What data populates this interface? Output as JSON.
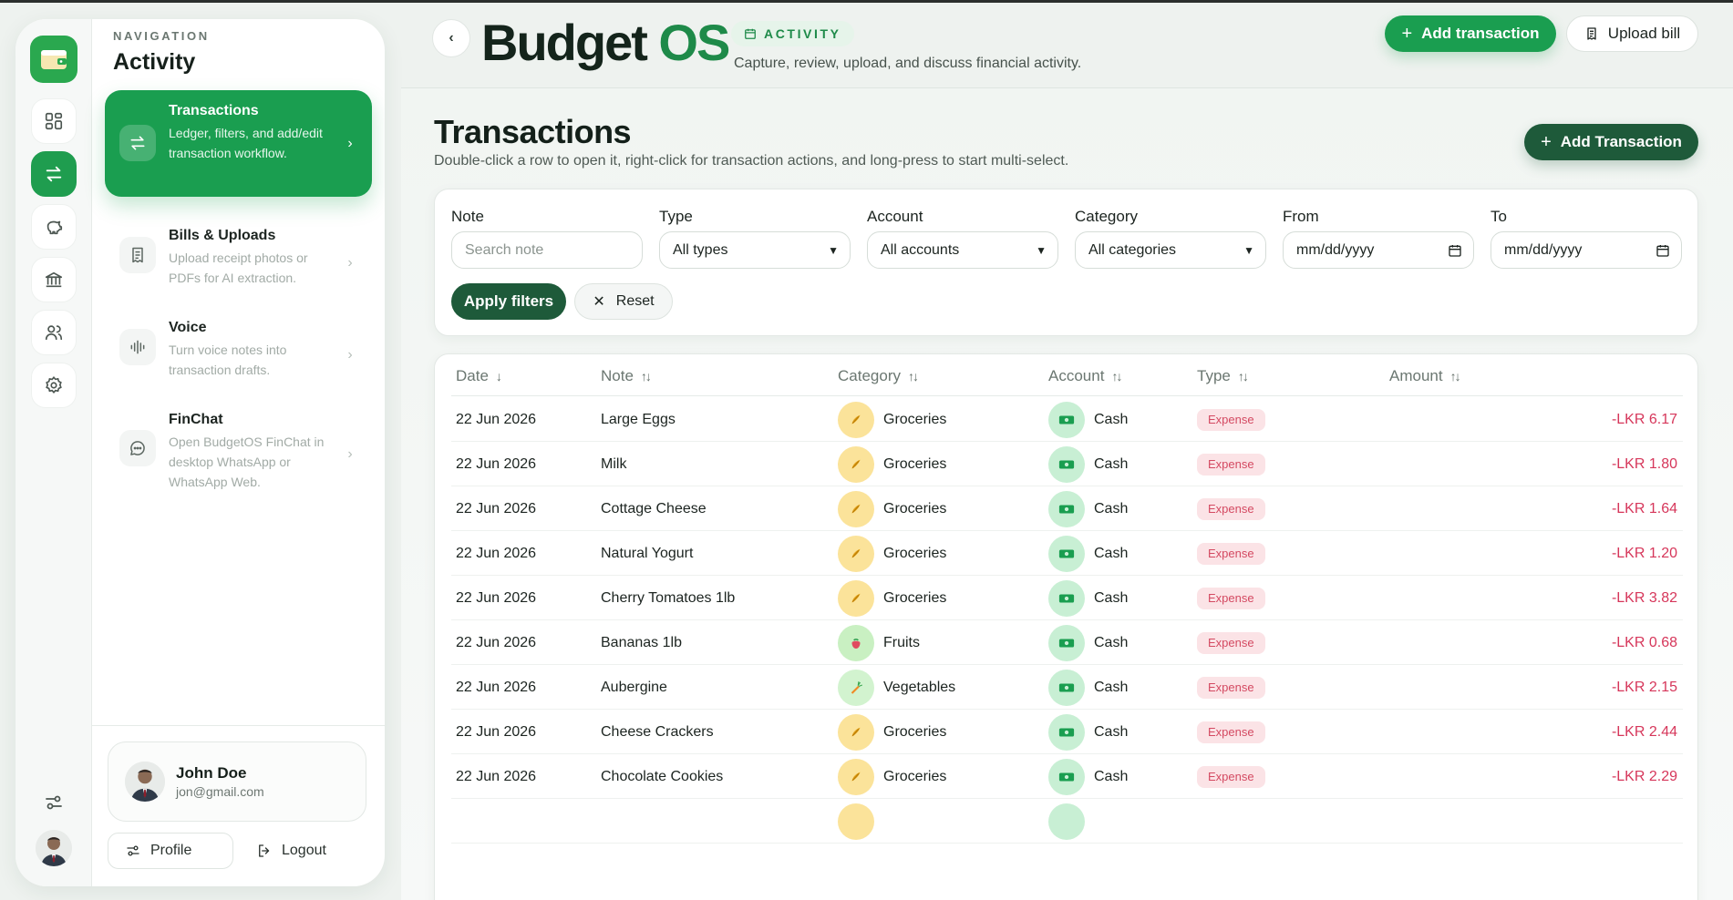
{
  "sidebar": {
    "eyebrow": "NAVIGATION",
    "title": "Activity",
    "items": [
      {
        "label": "Transactions",
        "desc": "Ledger, filters, and add/edit transaction workflow.",
        "icon": "arrows-swap-icon",
        "active": true
      },
      {
        "label": "Bills & Uploads",
        "desc": "Upload receipt photos or PDFs for AI extraction.",
        "icon": "receipt-icon",
        "active": false
      },
      {
        "label": "Voice",
        "desc": "Turn voice notes into transaction drafts.",
        "icon": "waveform-icon",
        "active": false
      },
      {
        "label": "FinChat",
        "desc": "Open BudgetOS FinChat in desktop WhatsApp or WhatsApp Web.",
        "icon": "chat-icon",
        "active": false
      }
    ],
    "rail_icons": [
      "wallet-logo-icon",
      "dashboard-icon",
      "arrows-swap-icon",
      "piggy-bank-icon",
      "bank-icon",
      "users-icon",
      "gear-icon",
      "sliders-icon"
    ],
    "user": {
      "name": "John Doe",
      "email": "jon@gmail.com"
    },
    "profile_label": "Profile",
    "logout_label": "Logout"
  },
  "header": {
    "brand_part1": "Budget",
    "brand_part2": "OS",
    "badge": "ACTIVITY",
    "subtitle": "Capture, review, upload, and discuss financial activity.",
    "add_transaction": "Add transaction",
    "upload_bill": "Upload bill"
  },
  "page": {
    "title": "Transactions",
    "subtitle": "Double-click a row to open it, right-click for transaction actions, and long-press to start multi-select.",
    "add_button": "Add Transaction"
  },
  "filters": {
    "note": {
      "label": "Note",
      "placeholder": "Search note"
    },
    "type": {
      "label": "Type",
      "value": "All types"
    },
    "account": {
      "label": "Account",
      "value": "All accounts"
    },
    "category": {
      "label": "Category",
      "value": "All categories"
    },
    "from": {
      "label": "From",
      "value": "mm/dd/yyyy"
    },
    "to": {
      "label": "To",
      "value": "mm/dd/yyyy"
    },
    "apply": "Apply filters",
    "reset": "Reset"
  },
  "table": {
    "columns": [
      "Date",
      "Note",
      "Category",
      "Account",
      "Type",
      "Amount"
    ],
    "rows": [
      {
        "date": "22 Jun 2026",
        "note": "Large Eggs",
        "category": "Groceries",
        "account": "Cash",
        "type": "Expense",
        "amount": "-LKR 6.17"
      },
      {
        "date": "22 Jun 2026",
        "note": "Milk",
        "category": "Groceries",
        "account": "Cash",
        "type": "Expense",
        "amount": "-LKR 1.80"
      },
      {
        "date": "22 Jun 2026",
        "note": "Cottage Cheese",
        "category": "Groceries",
        "account": "Cash",
        "type": "Expense",
        "amount": "-LKR 1.64"
      },
      {
        "date": "22 Jun 2026",
        "note": "Natural Yogurt",
        "category": "Groceries",
        "account": "Cash",
        "type": "Expense",
        "amount": "-LKR 1.20"
      },
      {
        "date": "22 Jun 2026",
        "note": "Cherry Tomatoes 1lb",
        "category": "Groceries",
        "account": "Cash",
        "type": "Expense",
        "amount": "-LKR 3.82"
      },
      {
        "date": "22 Jun 2026",
        "note": "Bananas 1lb",
        "category": "Fruits",
        "account": "Cash",
        "type": "Expense",
        "amount": "-LKR 0.68"
      },
      {
        "date": "22 Jun 2026",
        "note": "Aubergine",
        "category": "Vegetables",
        "account": "Cash",
        "type": "Expense",
        "amount": "-LKR 2.15"
      },
      {
        "date": "22 Jun 2026",
        "note": "Cheese Crackers",
        "category": "Groceries",
        "account": "Cash",
        "type": "Expense",
        "amount": "-LKR 2.44"
      },
      {
        "date": "22 Jun 2026",
        "note": "Chocolate Cookies",
        "category": "Groceries",
        "account": "Cash",
        "type": "Expense",
        "amount": "-LKR 2.29"
      },
      {
        "date": "",
        "note": "",
        "category": "",
        "account": "",
        "type": "",
        "amount": ""
      }
    ]
  },
  "colors": {
    "accent": "#1a9e50",
    "dark_accent": "#1e5a3a",
    "expense": "#d6365a",
    "groceries_chip": "#fbe39a",
    "fruits_chip": "#c9f0c2",
    "vegetables_chip": "#d2f3cf",
    "cash_chip": "#c8efd4"
  }
}
